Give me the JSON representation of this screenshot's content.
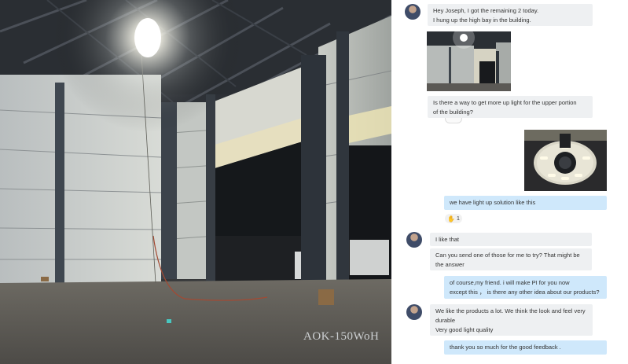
{
  "photo": {
    "watermark": "AOK-150WoH"
  },
  "chat": {
    "messages": [
      {
        "side": "left",
        "lines": [
          "Hey Joseph, I got the remaining 2 today.",
          "I hung up the high bay in the building."
        ]
      },
      {
        "side": "left",
        "type": "image",
        "description_name": "warehouse-photo-thumbnail"
      },
      {
        "side": "left",
        "lines": [
          "Is there a way to get more up light for the upper portion",
          "of the building?"
        ]
      },
      {
        "side": "right",
        "type": "image",
        "description_name": "ufo-light-product-thumbnail"
      },
      {
        "side": "right",
        "lines": [
          "we have light up solution like this"
        ]
      },
      {
        "side": "left",
        "lines": [
          "I like that"
        ]
      },
      {
        "side": "left",
        "lines": [
          "Can you send one of those for me to try? That might be",
          "the answer"
        ]
      },
      {
        "side": "right",
        "lines": [
          "of course,my friend. i will make PI for you now",
          "except this ， is there any other idea about our products?"
        ]
      },
      {
        "side": "left",
        "lines": [
          "We like the products a lot.  We think the look and feel very",
          "durable"
        ]
      },
      {
        "side": "left",
        "lines": [
          "Very good light quality"
        ]
      },
      {
        "side": "right",
        "lines": [
          "thank you so much for the good feedback ."
        ]
      }
    ],
    "reaction": {
      "icon": "thumbs-up-icon",
      "count": "1"
    }
  }
}
